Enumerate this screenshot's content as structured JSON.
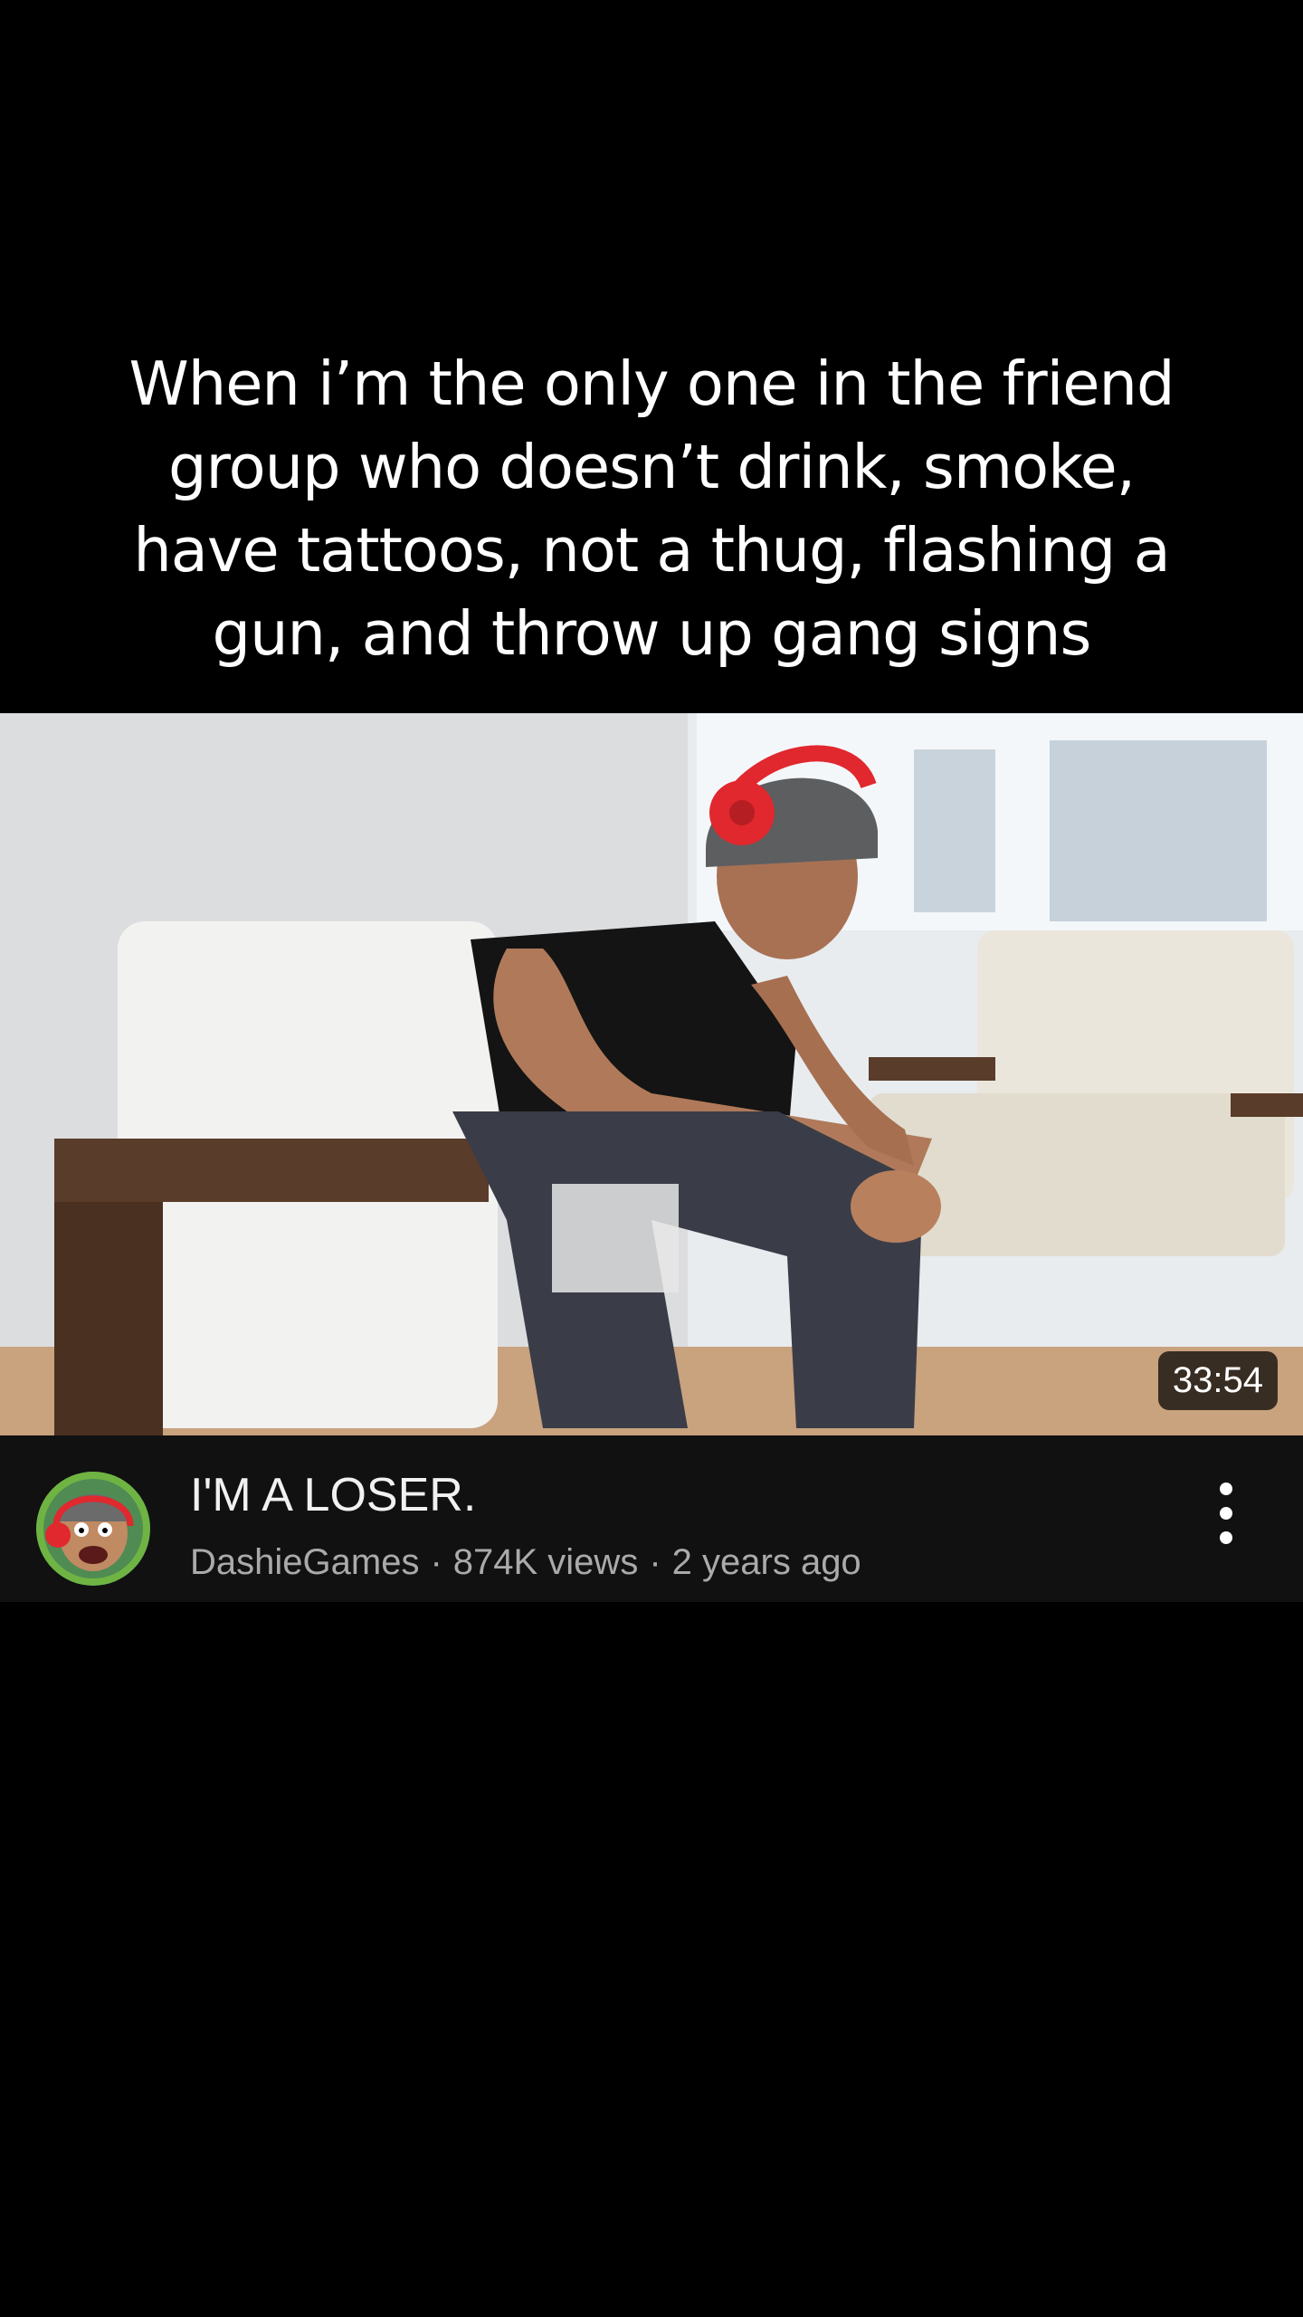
{
  "caption": {
    "line1": "When i’m the only one in the friend",
    "line2": "group who doesn’t drink, smoke,",
    "line3": "have tattoos, not a thug, flashing a",
    "line4": "gun, and throw up gang signs"
  },
  "video": {
    "duration": "33:54",
    "title": "I'M A LOSER.",
    "channel": "DashieGames",
    "views": "874K views",
    "age": "2 years ago",
    "separator": "·",
    "more_icon": "vertical-ellipsis-icon",
    "avatar_icon": "channel-avatar"
  }
}
